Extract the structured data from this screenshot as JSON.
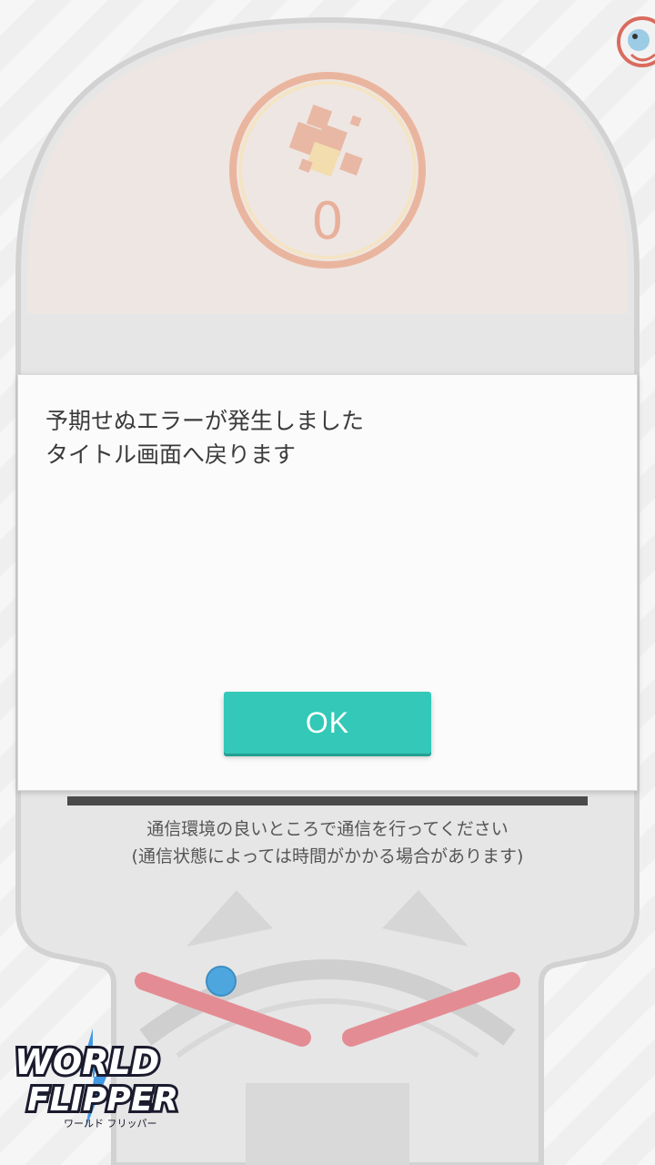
{
  "board": {
    "score": "0"
  },
  "dialog": {
    "message_lines": [
      "予期せぬエラーが発生しました",
      "タイトル画面へ戻ります"
    ],
    "ok_label": "OK"
  },
  "notice": {
    "line1": "通信環境の良いところで通信を行ってください",
    "line2": "(通信状態によっては時間がかかる場合があります)"
  },
  "logo": {
    "title_line1": "WORLD",
    "title_line2": "FLIPPER",
    "subtitle": "ワールド フリッパー"
  },
  "colors": {
    "accent_button": "#33c8b8",
    "flipper": "#e48c94",
    "ball": "#4ea6de",
    "score_ring": "#eab59e"
  }
}
